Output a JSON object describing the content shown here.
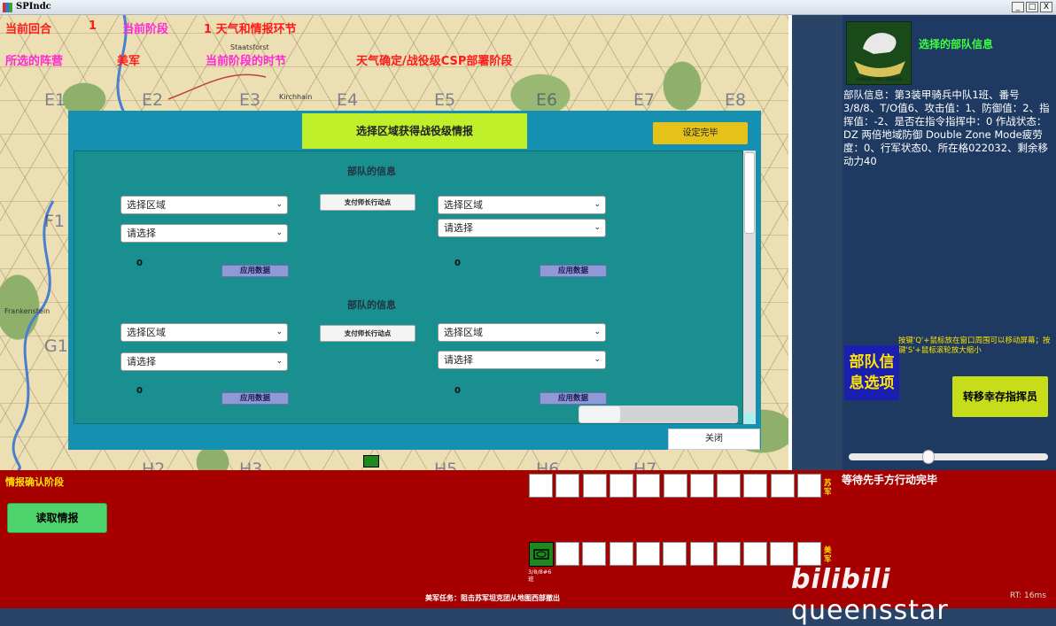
{
  "window": {
    "title": "SPIndc",
    "min": "_",
    "max": "□",
    "close": "X"
  },
  "hud": {
    "turn_label": "当前回合",
    "turn_value": "1",
    "phase_label": "当前阶段",
    "phase_value": "1 天气和情报环节",
    "faction_label": "所选的阵营",
    "faction_value": "美军",
    "time_label": "当前阶段的时节",
    "subphase": "天气确定/战役级CSP部署阶段"
  },
  "map": {
    "hex_ids": [
      "E1",
      "E2",
      "E3",
      "E4",
      "E5",
      "E6",
      "E7",
      "E8",
      "F1",
      "G1",
      "H2",
      "H3",
      "H5",
      "H6",
      "H7"
    ],
    "towns": [
      "Staatsforst",
      "Kirchhain",
      "Frankenstein"
    ]
  },
  "dialog": {
    "title": "选择区域获得战役级情报",
    "done_button": "设定完毕",
    "close_button": "关闭",
    "sections": [
      {
        "title": "部队的信息",
        "left": {
          "region": "选择区域",
          "choice": "请选择",
          "value": "0",
          "apply": "应用数据"
        },
        "pay_button": "支付师长行动点",
        "right": {
          "region": "选择区域",
          "choice": "请选择",
          "value": "0",
          "apply": "应用数据"
        }
      },
      {
        "title": "部队的信息",
        "left": {
          "region": "选择区域",
          "choice": "请选择",
          "value": "0",
          "apply": "应用数据"
        },
        "pay_button": "支付师长行动点",
        "right": {
          "region": "选择区域",
          "choice": "请选择",
          "value": "0",
          "apply": "应用数据"
        }
      }
    ]
  },
  "right_panel": {
    "selected_title": "选择的部队信息",
    "badge_motto": "HONOR AND COURAGE",
    "unit_info": "部队信息：第3装甲骑兵中队1班、番号3/8/8、T/O值6、攻击值：1、防御值：2、指挥值：-2、是否在指令指挥中：0 作战状态：DZ 两倍地域防御 Double Zone Mode疲劳度：0、行军状态0、所在格022032、剩余移动力40",
    "hint": "按键'Q'+鼠标放在窗口周围可以移动屏幕；按键'S'+鼠标滚轮放大缩小",
    "options_button": "部队信息选项",
    "transfer_button": "转移幸存指挥员",
    "zoom_level": 0.4
  },
  "bottom": {
    "phase": "情报确认阶段",
    "read_button": "读取情报",
    "wait_status": "等待先手方行动完毕",
    "soviet_label": "苏军",
    "us_label": "美军",
    "unit_caption": "3/8/8#6班",
    "mission": "美军任务：阻击苏军坦克团从地图西部撤出",
    "watermark": "queensstar",
    "watermark_logo": "bilibili",
    "fps": "RT: 16ms"
  },
  "colors": {
    "dialog_bg": "#1590b0",
    "bottom_bg": "#a70000",
    "panel_bg": "#1f3a62",
    "title_accent": "#bff02a"
  }
}
